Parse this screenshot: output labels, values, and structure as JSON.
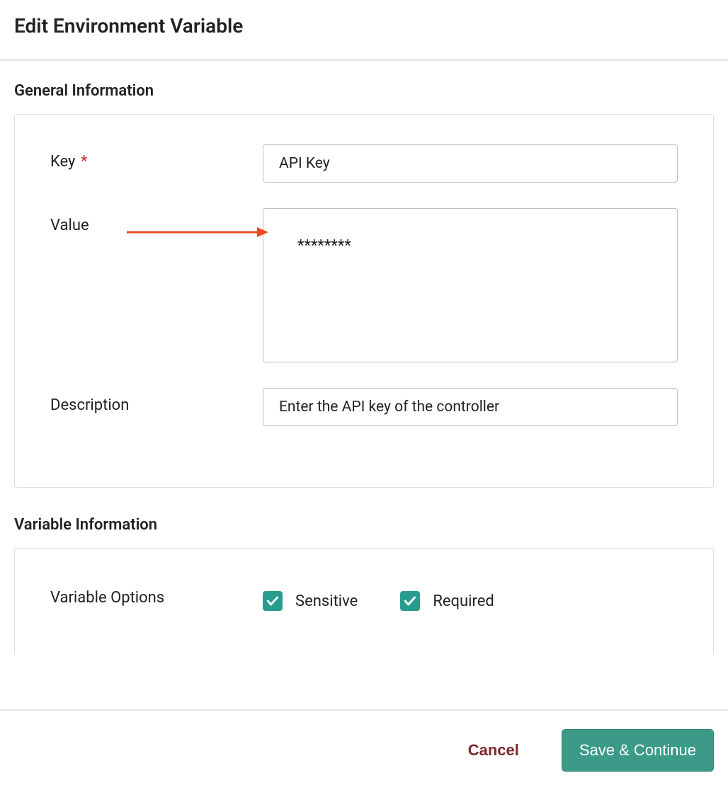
{
  "page_title": "Edit Environment Variable",
  "sections": {
    "general": {
      "title": "General Information",
      "fields": {
        "key": {
          "label": "Key",
          "required_marker": "*",
          "value": "API Key"
        },
        "value": {
          "label": "Value",
          "value": "********"
        },
        "description": {
          "label": "Description",
          "value": "Enter the API key of the controller"
        }
      }
    },
    "variable": {
      "title": "Variable Information",
      "options_label": "Variable Options",
      "options": {
        "sensitive": {
          "label": "Sensitive",
          "checked": true
        },
        "required": {
          "label": "Required",
          "checked": true
        }
      }
    }
  },
  "footer": {
    "cancel": "Cancel",
    "save": "Save & Continue"
  },
  "annotation": {
    "arrow_color": "#e94b25"
  }
}
